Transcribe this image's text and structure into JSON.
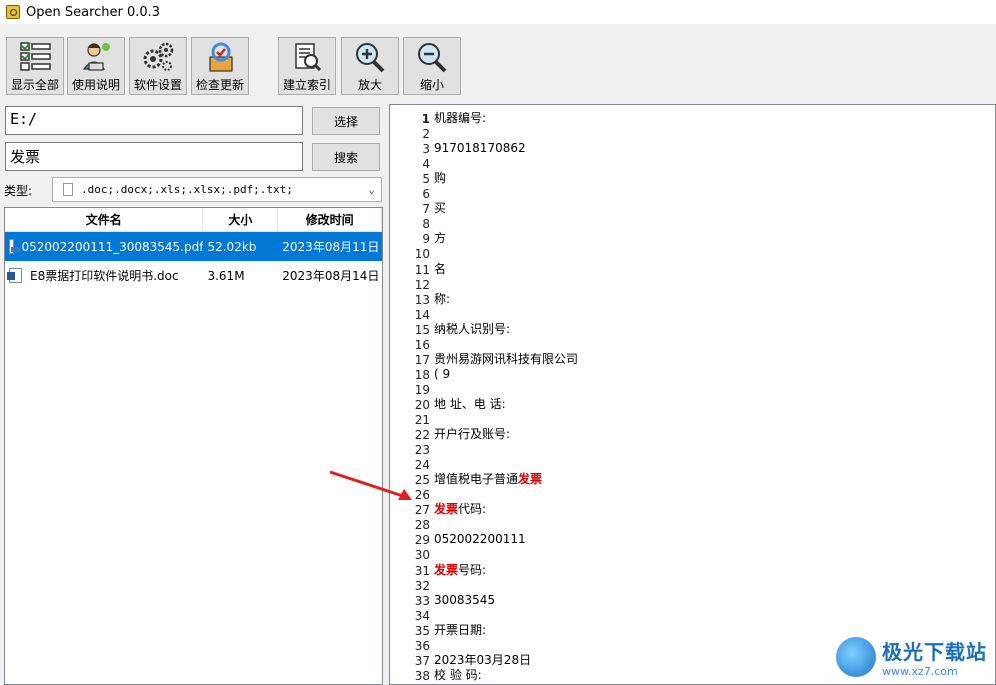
{
  "window": {
    "title": "Open Searcher 0.0.3"
  },
  "toolbar": {
    "buttons": [
      {
        "label": "显示全部",
        "icon": "checklist-icon"
      },
      {
        "label": "使用说明",
        "icon": "user-guide-icon"
      },
      {
        "label": "软件设置",
        "icon": "gears-icon"
      },
      {
        "label": "检查更新",
        "icon": "update-check-icon"
      },
      {
        "label": "建立索引",
        "icon": "index-build-icon"
      },
      {
        "label": "放大",
        "icon": "zoom-in-icon"
      },
      {
        "label": "缩小",
        "icon": "zoom-out-icon"
      }
    ]
  },
  "search": {
    "path_value": "E:/",
    "select_label": "选择",
    "keyword_value": "发票",
    "search_label": "搜索",
    "type_label": "类型:",
    "type_value": ".doc;.docx;.xls;.xlsx;.pdf;.txt;"
  },
  "results": {
    "columns": [
      "文件名",
      "大小",
      "修改时间"
    ],
    "rows": [
      {
        "name": "052002200111_30083545.pdf",
        "size": "52.02kb",
        "modified": "2023年08月11日 .",
        "icon": "pdf-file-icon",
        "selected": true
      },
      {
        "name": "E8票据打印软件说明书.doc",
        "size": "3.61M",
        "modified": "2023年08月14日 .",
        "icon": "word-file-icon",
        "selected": false
      }
    ]
  },
  "viewer": {
    "line_numbers": [
      "1",
      "2",
      "3",
      "4",
      "5",
      "6",
      "7",
      "8",
      "9",
      "10",
      "11",
      "12",
      "13",
      "14",
      "15",
      "16",
      "17",
      "18",
      "19",
      "20",
      "21",
      "22",
      "23",
      "24",
      "25",
      "26",
      "27",
      "28",
      "29",
      "30",
      "31",
      "32",
      "33",
      "34",
      "35",
      "36",
      "37",
      "38"
    ],
    "lines": [
      {
        "n": 1,
        "pre": "机器编号:",
        "hl": "",
        "post": ""
      },
      {
        "n": 3,
        "pre": "917018170862",
        "hl": "",
        "post": ""
      },
      {
        "n": 5,
        "pre": "购",
        "hl": "",
        "post": ""
      },
      {
        "n": 7,
        "pre": "买",
        "hl": "",
        "post": ""
      },
      {
        "n": 9,
        "pre": "方",
        "hl": "",
        "post": ""
      },
      {
        "n": 11,
        "pre": "名",
        "hl": "",
        "post": ""
      },
      {
        "n": 13,
        "pre": "称:",
        "hl": "",
        "post": ""
      },
      {
        "n": 15,
        "pre": "纳税人识别号:",
        "hl": "",
        "post": ""
      },
      {
        "n": 17,
        "pre": "贵州易游网讯科技有限公司",
        "hl": "",
        "post": ""
      },
      {
        "n": 18,
        "pre": "(                   9",
        "hl": "",
        "post": ""
      },
      {
        "n": 20,
        "pre": "地  址、电  话:",
        "hl": "",
        "post": ""
      },
      {
        "n": 22,
        "pre": "开户行及账号:",
        "hl": "",
        "post": ""
      },
      {
        "n": 25,
        "pre": "增值税电子普通",
        "hl": "发票",
        "post": ""
      },
      {
        "n": 27,
        "pre": "",
        "hl": "发票",
        "post": "代码:"
      },
      {
        "n": 29,
        "pre": "052002200111",
        "hl": "",
        "post": ""
      },
      {
        "n": 31,
        "pre": "",
        "hl": "发票",
        "post": "号码:"
      },
      {
        "n": 33,
        "pre": "30083545",
        "hl": "",
        "post": ""
      },
      {
        "n": 35,
        "pre": "开票日期:",
        "hl": "",
        "post": ""
      },
      {
        "n": 37,
        "pre": "2023年03月28日",
        "hl": "",
        "post": ""
      },
      {
        "n": 38,
        "pre": "校  验  码:",
        "hl": "",
        "post": ""
      }
    ]
  },
  "watermark": {
    "cn": "极光下载站",
    "url": "www.xz7.com"
  },
  "colors": {
    "selection": "#0078d7",
    "highlight": "#e00000",
    "arrow": "#e02020"
  }
}
